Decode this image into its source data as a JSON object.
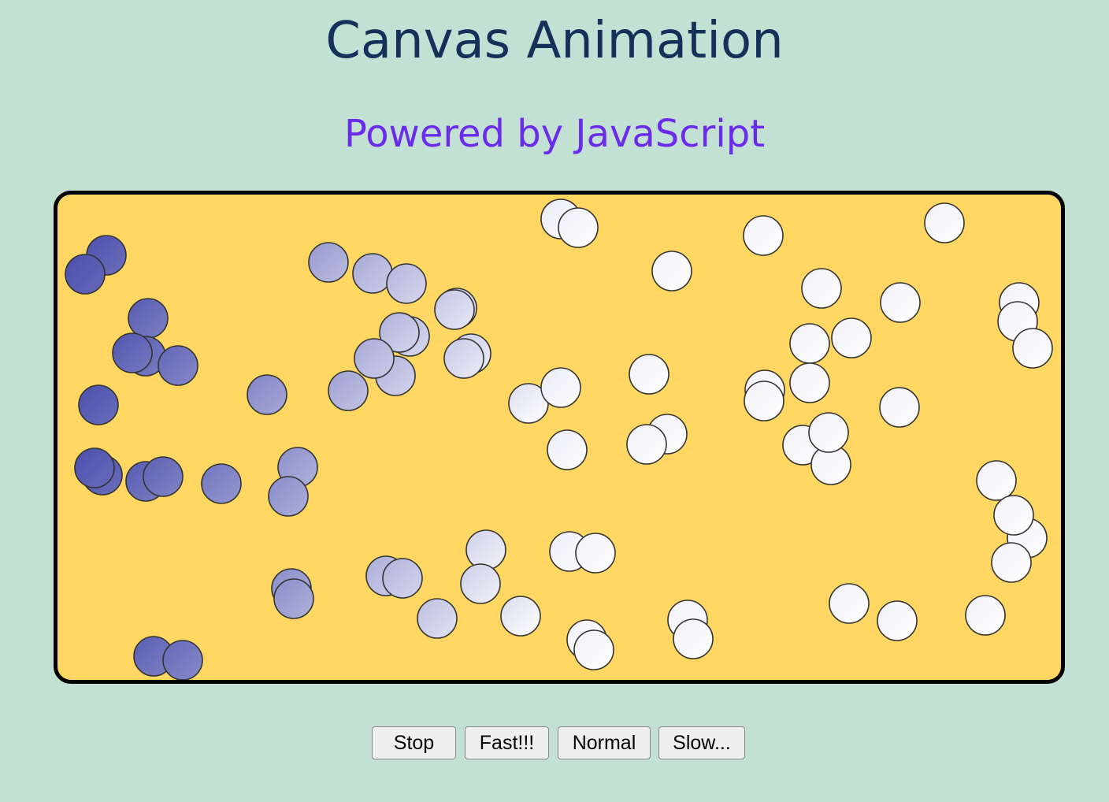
{
  "page": {
    "title": "Canvas Animation",
    "subtitle": "Powered by JavaScript"
  },
  "canvas": {
    "background": "#ffd762",
    "border_color": "#000000",
    "ball_color_start": "#4b4fac",
    "ball_color_end": "#ffffff"
  },
  "controls": {
    "stop_label": "Stop",
    "fast_label": "Fast!!!",
    "normal_label": "Normal",
    "slow_label": "Slow..."
  },
  "colors": {
    "page_background": "#c3e0d4",
    "title_color": "#16305a",
    "subtitle_color": "#6a2bea"
  }
}
